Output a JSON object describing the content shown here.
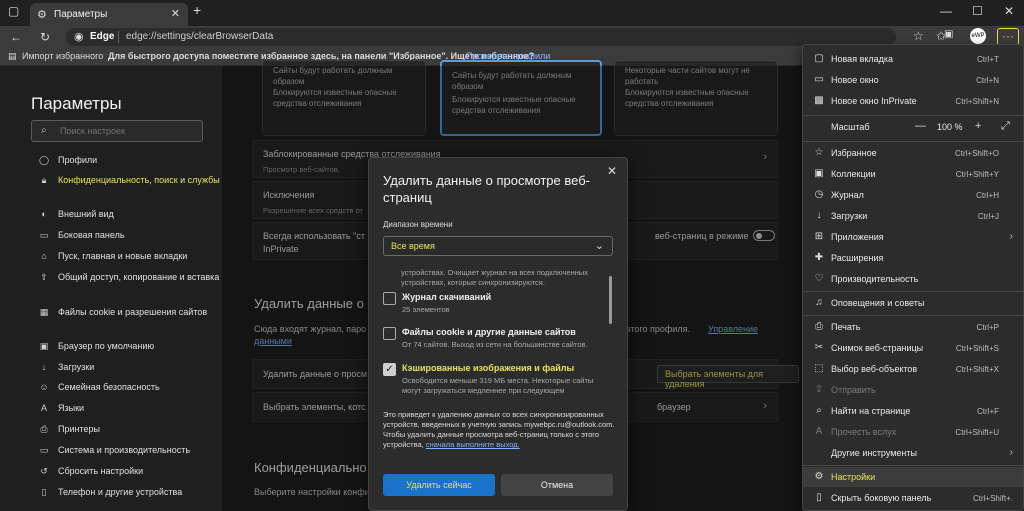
{
  "window": {
    "tab_title": "Параметры",
    "url_host_label": "Edge",
    "url": "edge://settings/clearBrowserData"
  },
  "favorites_bar": {
    "import_label": "Импорт избранного",
    "prompt": "Для быстрого доступа поместите избранное здесь, на панели \"Избранное\". Ищете избранное?",
    "link": "Проверьте профили"
  },
  "sidebar": {
    "title": "Параметры",
    "search_placeholder": "Поиск настроек",
    "items": [
      {
        "label": "Профили",
        "icon": "person-icon"
      },
      {
        "label": "Конфиденциальность, поиск и службы",
        "icon": "lock-icon",
        "active": true
      },
      {
        "label": "Внешний вид",
        "icon": "palette-icon"
      },
      {
        "label": "Боковая панель",
        "icon": "sidebar-icon"
      },
      {
        "label": "Пуск, главная и новые вкладки",
        "icon": "home-icon"
      },
      {
        "label": "Общий доступ, копирование и вставка",
        "icon": "share-icon"
      },
      {
        "label": "Файлы cookie и разрешения сайтов",
        "icon": "cookie-icon"
      },
      {
        "label": "Браузер по умолчанию",
        "icon": "browser-icon"
      },
      {
        "label": "Загрузки",
        "icon": "download-icon"
      },
      {
        "label": "Семейная безопасность",
        "icon": "family-icon"
      },
      {
        "label": "Языки",
        "icon": "language-icon"
      },
      {
        "label": "Принтеры",
        "icon": "printer-icon"
      },
      {
        "label": "Система и производительность",
        "icon": "system-icon"
      },
      {
        "label": "Сбросить настройки",
        "icon": "reset-icon"
      },
      {
        "label": "Телефон и другие устройства",
        "icon": "phone-icon"
      }
    ]
  },
  "main": {
    "card1_line1": "Сайты будут работать должным образом",
    "card1_line2": "Блокируются известные опасные средства отслеживания",
    "card2_line1": "Сайты будут работать должным образом",
    "card2_line2": "Блокируются известные опасные средства отслеживания",
    "card3_line1": "Некоторые части сайтов могут не работать",
    "card3_line2": "Блокируются известные опасные средства отслеживания",
    "blocked_trackers": "Заблокированные средства отслеживания",
    "blocked_trackers_sub": "Просмотр веб-сайтов,",
    "exceptions": "Исключения",
    "exceptions_sub": "Разрешение всех средств от",
    "always_use": "Всегда использовать \"ст",
    "always_use_tail": "веб-страниц в режиме",
    "always_use_line2": "InPrivate",
    "clear_header": "Удалить данные о",
    "clear_desc": "Сюда входят журнал, паро",
    "clear_desc_tail": "этого профиля.",
    "manage_link": "Управление",
    "manage_link2": "данными",
    "clear_now_row": "Удалить данные о просм",
    "choose_btn": "Выбрать элементы для удаления",
    "choose_row": "Выбрать элементы, котс",
    "choose_row_tail": "браузер",
    "privacy_header": "Конфиденциально",
    "privacy_desc": "Выберите настройки конфи"
  },
  "dialog": {
    "title": "Удалить данные о просмотре веб-страниц",
    "range_label": "Диапазон времени",
    "range_value": "Все время",
    "partial_text": "устройствах. Очищает журнал на всех подключенных устройствах, которые синхронизируются.",
    "items": [
      {
        "title": "Журнал скачиваний",
        "sub": "25 элементов",
        "checked": false
      },
      {
        "title": "Файлы cookie и другие данные сайтов",
        "sub": "От 74 сайтов. Выход из сети на большинстве сайтов.",
        "checked": false
      },
      {
        "title": "Кэшированные изображения и файлы",
        "sub": "Освободится меньше 319 МБ места. Некоторые сайты могут загружаться медленнее при следующем",
        "checked": true
      }
    ],
    "note": "Это приведет к удалению данных со всех синхронизированных устройств, введенных в учетную запись mywebpc.ru@outlook.com. Чтобы удалить данные просмотра веб-страниц только с этого устройства,",
    "note_link": "сначала выполните выход.",
    "delete_label": "Удалить сейчас",
    "cancel_label": "Отмена"
  },
  "menu": {
    "items": [
      {
        "label": "Новая вкладка",
        "shortcut": "Ctrl+T",
        "icon": "new-tab-icon"
      },
      {
        "label": "Новое окно",
        "shortcut": "Ctrl+N",
        "icon": "new-window-icon"
      },
      {
        "label": "Новое окно InPrivate",
        "shortcut": "Ctrl+Shift+N",
        "icon": "inprivate-icon"
      },
      {
        "label": "Избранное",
        "shortcut": "Ctrl+Shift+O",
        "icon": "favorites-icon"
      },
      {
        "label": "Коллекции",
        "shortcut": "Ctrl+Shift+Y",
        "icon": "collections-icon"
      },
      {
        "label": "Журнал",
        "shortcut": "Ctrl+H",
        "icon": "history-icon"
      },
      {
        "label": "Загрузки",
        "shortcut": "Ctrl+J",
        "icon": "downloads-icon"
      },
      {
        "label": "Приложения",
        "shortcut": "",
        "icon": "apps-icon",
        "submenu": true
      },
      {
        "label": "Расширения",
        "shortcut": "",
        "icon": "extensions-icon"
      },
      {
        "label": "Производительность",
        "shortcut": "",
        "icon": "performance-icon"
      },
      {
        "label": "Оповещения и советы",
        "shortcut": "",
        "icon": "bell-icon"
      },
      {
        "label": "Печать",
        "shortcut": "Ctrl+P",
        "icon": "print-icon"
      },
      {
        "label": "Снимок веб-страницы",
        "shortcut": "Ctrl+Shift+S",
        "icon": "screenshot-icon"
      },
      {
        "label": "Выбор веб-объектов",
        "shortcut": "Ctrl+Shift+X",
        "icon": "web-select-icon"
      },
      {
        "label": "Отправить",
        "shortcut": "",
        "icon": "share-icon",
        "disabled": true
      },
      {
        "label": "Найти на странице",
        "shortcut": "Ctrl+F",
        "icon": "find-icon"
      },
      {
        "label": "Прочесть вслух",
        "shortcut": "Ctrl+Shift+U",
        "icon": "read-aloud-icon",
        "disabled": true
      },
      {
        "label": "Другие инструменты",
        "shortcut": "",
        "icon": "tools-icon",
        "submenu": true
      },
      {
        "label": "Настройки",
        "shortcut": "",
        "icon": "gear-icon",
        "highlight": true
      },
      {
        "label": "Скрыть боковую панель",
        "shortcut": "Ctrl+Shift+.",
        "icon": "sidebar-hide-icon"
      }
    ],
    "zoom_label": "Масштаб",
    "zoom_value": "100 %"
  },
  "colors": {
    "highlight_yellow": "#e8e35a",
    "accent_blue": "#1a73c8",
    "link_blue": "#7fb6ff"
  }
}
